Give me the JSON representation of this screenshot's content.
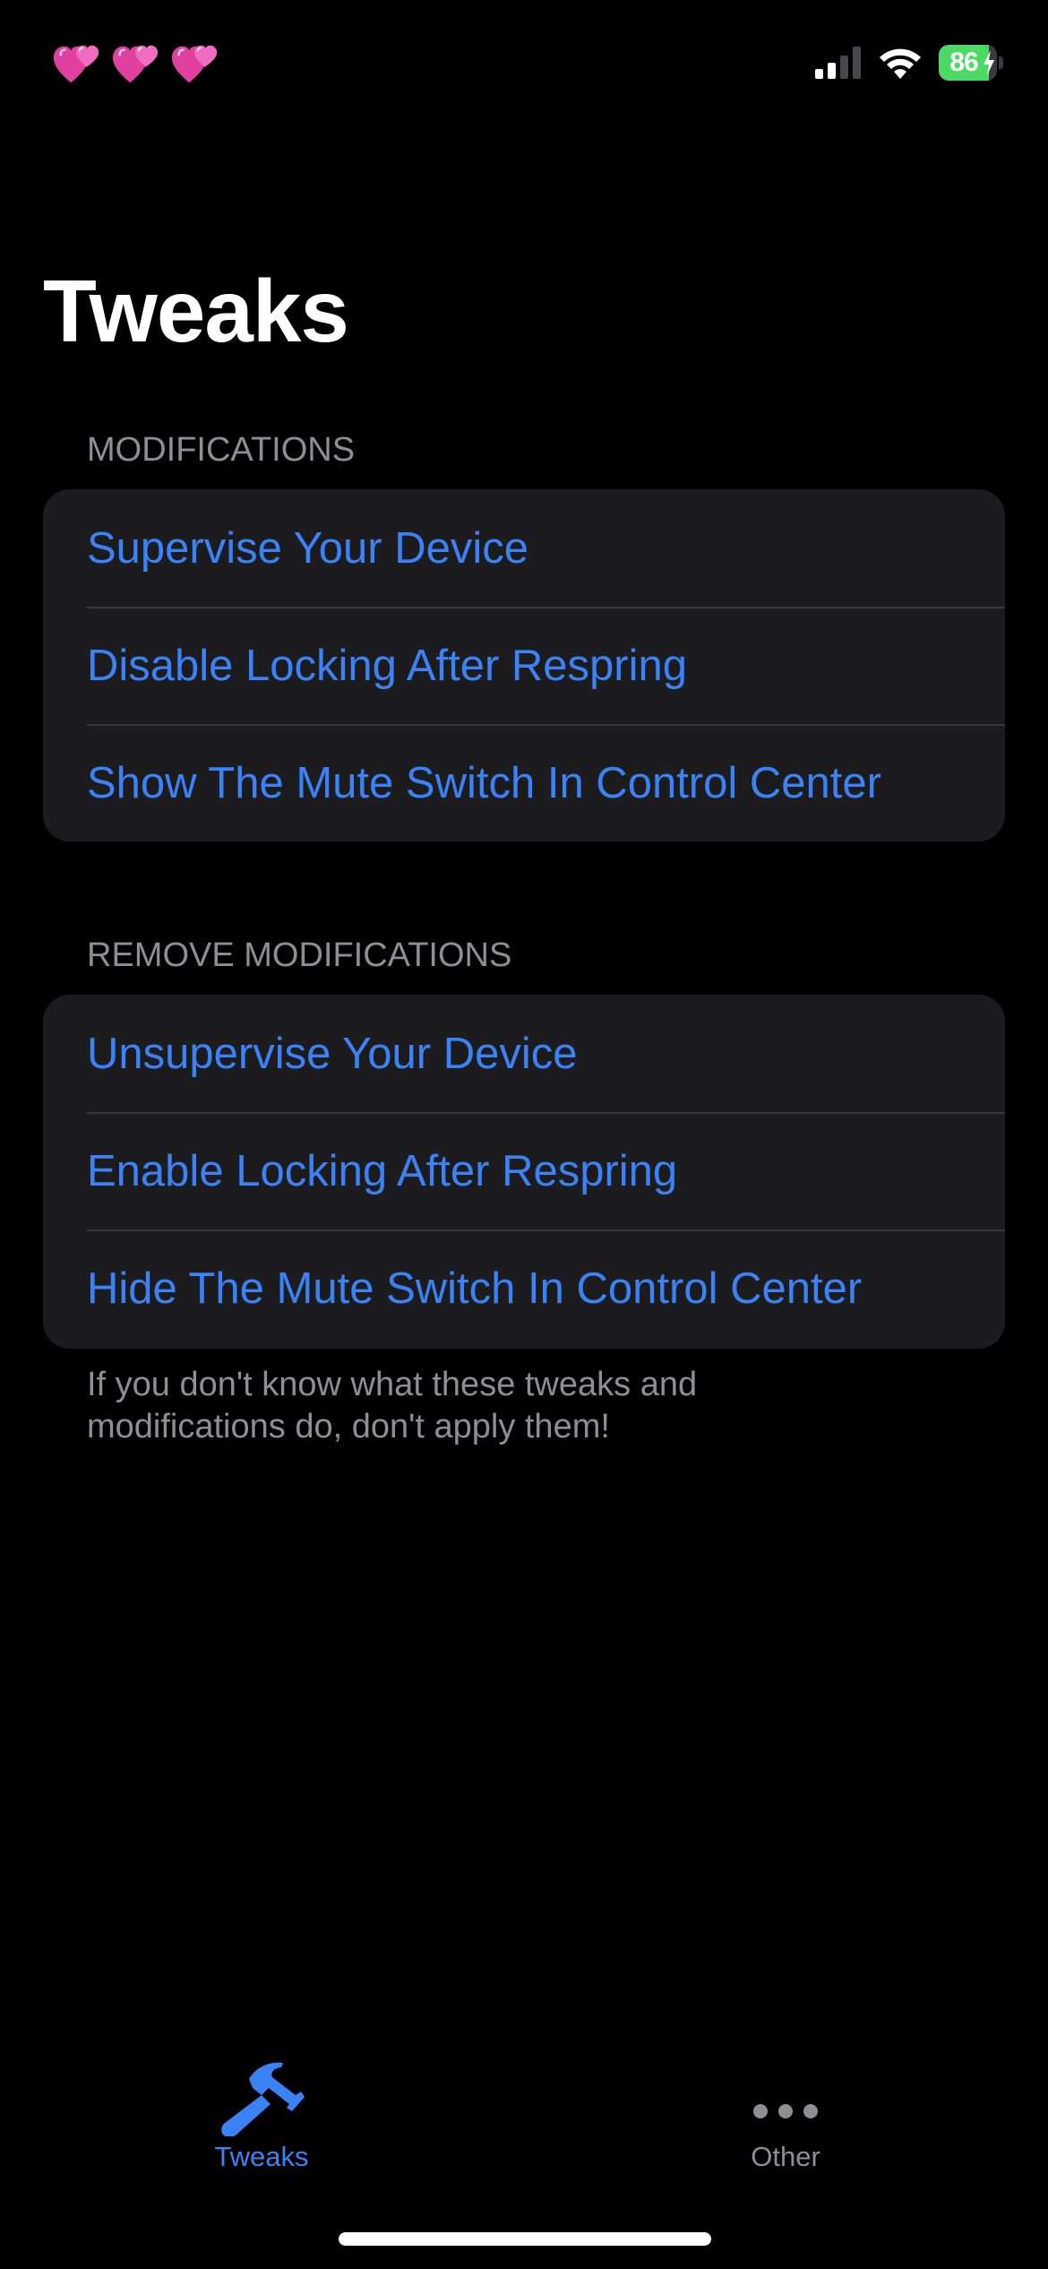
{
  "status_bar": {
    "left_icons": [
      "heart-emoji-icon",
      "heart-emoji-icon",
      "heart-emoji-icon"
    ],
    "signal_bars_active": 2,
    "signal_bars_total": 4,
    "battery_level": "86",
    "battery_fraction": 0.86,
    "charging": true,
    "colors": {
      "battery_fill": "#4cd964",
      "heart": "#e040a0"
    }
  },
  "page": {
    "title": "Tweaks"
  },
  "sections": [
    {
      "header": "MODIFICATIONS",
      "items": [
        {
          "label": "Supervise Your Device"
        },
        {
          "label": "Disable Locking After Respring"
        },
        {
          "label": "Show The Mute Switch In Control Center"
        }
      ]
    },
    {
      "header": "REMOVE MODIFICATIONS",
      "items": [
        {
          "label": "Unsupervise Your Device"
        },
        {
          "label": "Enable Locking After Respring"
        },
        {
          "label": "Hide The Mute Switch In Control Center"
        }
      ],
      "footer": "If you don't know what these tweaks and modifications do, don't apply them!"
    }
  ],
  "tab_bar": {
    "tabs": [
      {
        "label": "Tweaks",
        "icon": "hammer-icon",
        "selected": true
      },
      {
        "label": "Other",
        "icon": "ellipsis-icon",
        "selected": false
      }
    ]
  },
  "colors": {
    "background": "#000000",
    "group_background": "#1c1c1e",
    "accent": "#3b82f6",
    "secondary_text": "#8e8e93",
    "separator": "#38383a"
  }
}
